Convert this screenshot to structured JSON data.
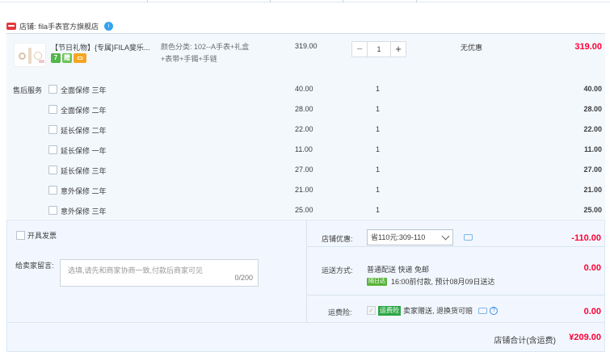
{
  "store": {
    "label": "店铺:",
    "name": "fila手表官方旗舰店",
    "badge": "i"
  },
  "product": {
    "title": "【节日礼物】{专属}FILA斐乐...",
    "badges": [
      {
        "text": "7",
        "color": "#52b64a"
      },
      {
        "text": "赠",
        "color": "#6fc25a"
      },
      {
        "text": "▭",
        "color": "#f5a623"
      }
    ],
    "sku_line1": "颜色分类: 102--A手表+礼盒",
    "sku_line2": "+表带+手镯+手链",
    "unit_price": "319.00",
    "quantity": "1",
    "minus": "−",
    "plus": "+",
    "discount": "无优惠",
    "subtotal": "319.00"
  },
  "services": {
    "label": "售后服务",
    "items": [
      {
        "name": "全面保修 三年",
        "price": "40.00",
        "qty": "1",
        "sum": "40.00"
      },
      {
        "name": "全面保修 二年",
        "price": "28.00",
        "qty": "1",
        "sum": "28.00"
      },
      {
        "name": "延长保修 二年",
        "price": "22.00",
        "qty": "1",
        "sum": "22.00"
      },
      {
        "name": "延长保修 一年",
        "price": "11.00",
        "qty": "1",
        "sum": "11.00"
      },
      {
        "name": "延长保修 三年",
        "price": "27.00",
        "qty": "1",
        "sum": "27.00"
      },
      {
        "name": "意外保修 二年",
        "price": "21.00",
        "qty": "1",
        "sum": "21.00"
      },
      {
        "name": "意外保修 三年",
        "price": "25.00",
        "qty": "1",
        "sum": "25.00"
      }
    ]
  },
  "order": {
    "invoice_label": "开具发票",
    "memo_label": "给卖家留言:",
    "memo_placeholder": "选填,请先和商家协商一致,付款后商家可见",
    "memo_count": "0/200",
    "store_discount_label": "店铺优惠:",
    "store_discount_value": "省110元:309-110",
    "store_discount_amount": "-110.00",
    "shipping_label": "运送方式:",
    "shipping_method": "普通配送 快递 免邮",
    "shipping_tag": "隔日达",
    "shipping_eta": "16:00前付款, 预计08月09日送达",
    "shipping_amount": "0.00",
    "insurance_label": "运费险:",
    "insurance_tag": "运费险",
    "insurance_text": "卖家赠送, 退换货可赔",
    "insurance_help": "?",
    "insurance_amount": "0.00"
  },
  "total": {
    "label": "店铺合计(含运费)",
    "value": "¥209.00"
  },
  "colors": {
    "accent_red": "#ff0036",
    "panel_bg": "#f3f8fd",
    "order_bg": "#f2f7ff"
  }
}
